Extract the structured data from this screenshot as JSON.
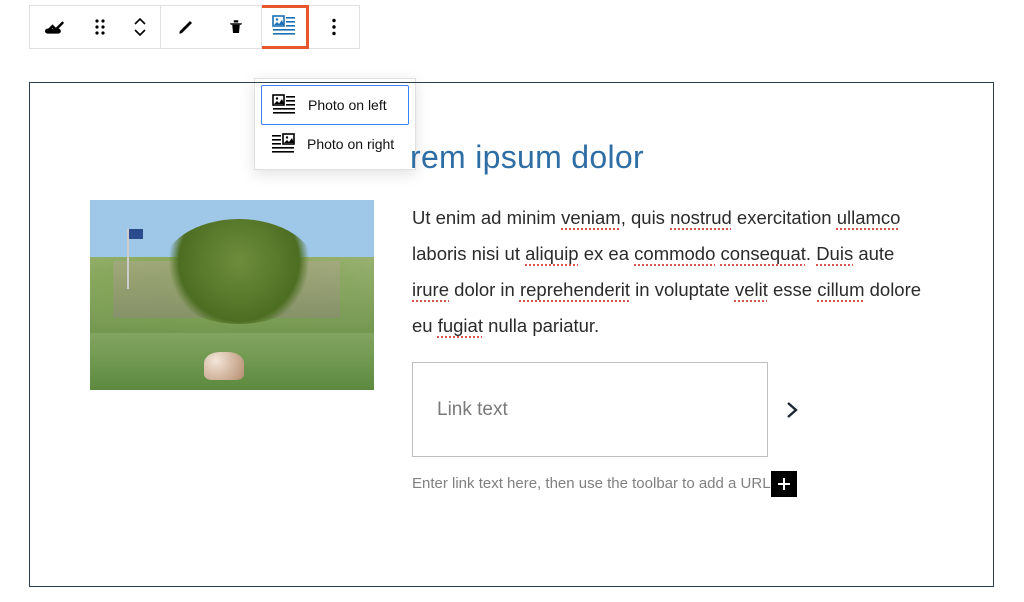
{
  "dropdown": {
    "option_left": "Photo on left",
    "option_right": "Photo on right"
  },
  "block": {
    "title": "rem ipsum dolor",
    "paragraph": {
      "pre1": "Ut enim ad minim ",
      "sp1": "veniam",
      "t1": ", quis ",
      "sp2": "nostrud",
      "t2": " exercitation ",
      "sp3": "ullamco",
      "t3": " laboris nisi ut ",
      "sp4": "aliquip",
      "t4": " ex ea ",
      "sp5": "commodo",
      "t5": " ",
      "sp6": "consequat",
      "t6": ". ",
      "sp7": "Duis",
      "t7": " aute ",
      "sp8": "irure",
      "t8": " dolor in ",
      "sp9": "reprehenderit",
      "t9": " in voluptate ",
      "sp10": "velit",
      "t10": " esse ",
      "sp11": "cillum",
      "t11": " dolore eu ",
      "sp12": "fugiat",
      "t12": " nulla pariatur."
    },
    "link_placeholder": "Link text",
    "helper": "Enter link text here, then use the toolbar to add a URL"
  }
}
